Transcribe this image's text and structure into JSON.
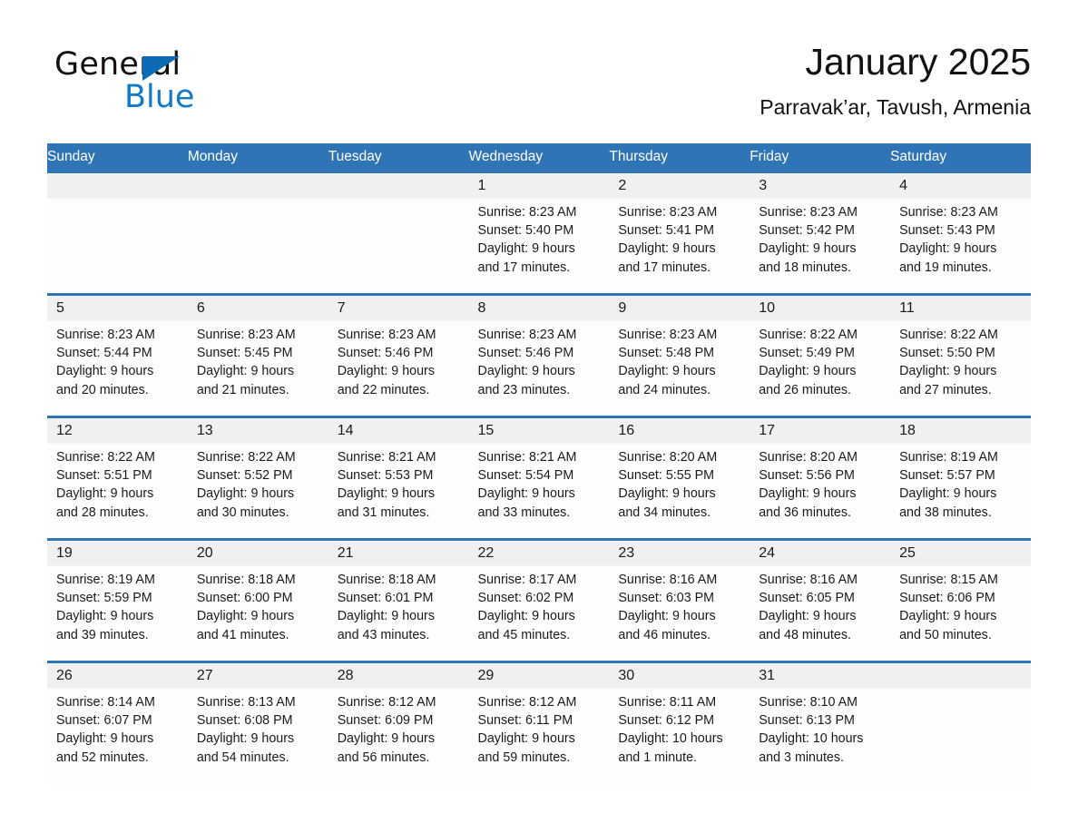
{
  "brand": {
    "name_part1": "General",
    "name_part2": "Blue",
    "triangle_color": "#0b6cb5",
    "blue_color": "#1179c6"
  },
  "header": {
    "title": "January 2025",
    "subtitle": "Parravak’ar, Tavush, Armenia"
  },
  "theme": {
    "header_blue": "#2f75b5",
    "daynum_band": "#f0f0f0",
    "cell_background": "#fdfdfd",
    "text_color": "#1a1a1a"
  },
  "calendar": {
    "weekdays": [
      "Sunday",
      "Monday",
      "Tuesday",
      "Wednesday",
      "Thursday",
      "Friday",
      "Saturday"
    ],
    "labels": {
      "sunrise": "Sunrise:",
      "sunset": "Sunset:",
      "daylight": "Daylight:"
    },
    "weeks": [
      [
        {
          "day": "",
          "l1": "",
          "l2": "",
          "l3": "",
          "l4": ""
        },
        {
          "day": "",
          "l1": "",
          "l2": "",
          "l3": "",
          "l4": ""
        },
        {
          "day": "",
          "l1": "",
          "l2": "",
          "l3": "",
          "l4": ""
        },
        {
          "day": "1",
          "l1": "Sunrise: 8:23 AM",
          "l2": "Sunset: 5:40 PM",
          "l3": "Daylight: 9 hours",
          "l4": "and 17 minutes."
        },
        {
          "day": "2",
          "l1": "Sunrise: 8:23 AM",
          "l2": "Sunset: 5:41 PM",
          "l3": "Daylight: 9 hours",
          "l4": "and 17 minutes."
        },
        {
          "day": "3",
          "l1": "Sunrise: 8:23 AM",
          "l2": "Sunset: 5:42 PM",
          "l3": "Daylight: 9 hours",
          "l4": "and 18 minutes."
        },
        {
          "day": "4",
          "l1": "Sunrise: 8:23 AM",
          "l2": "Sunset: 5:43 PM",
          "l3": "Daylight: 9 hours",
          "l4": "and 19 minutes."
        }
      ],
      [
        {
          "day": "5",
          "l1": "Sunrise: 8:23 AM",
          "l2": "Sunset: 5:44 PM",
          "l3": "Daylight: 9 hours",
          "l4": "and 20 minutes."
        },
        {
          "day": "6",
          "l1": "Sunrise: 8:23 AM",
          "l2": "Sunset: 5:45 PM",
          "l3": "Daylight: 9 hours",
          "l4": "and 21 minutes."
        },
        {
          "day": "7",
          "l1": "Sunrise: 8:23 AM",
          "l2": "Sunset: 5:46 PM",
          "l3": "Daylight: 9 hours",
          "l4": "and 22 minutes."
        },
        {
          "day": "8",
          "l1": "Sunrise: 8:23 AM",
          "l2": "Sunset: 5:46 PM",
          "l3": "Daylight: 9 hours",
          "l4": "and 23 minutes."
        },
        {
          "day": "9",
          "l1": "Sunrise: 8:23 AM",
          "l2": "Sunset: 5:48 PM",
          "l3": "Daylight: 9 hours",
          "l4": "and 24 minutes."
        },
        {
          "day": "10",
          "l1": "Sunrise: 8:22 AM",
          "l2": "Sunset: 5:49 PM",
          "l3": "Daylight: 9 hours",
          "l4": "and 26 minutes."
        },
        {
          "day": "11",
          "l1": "Sunrise: 8:22 AM",
          "l2": "Sunset: 5:50 PM",
          "l3": "Daylight: 9 hours",
          "l4": "and 27 minutes."
        }
      ],
      [
        {
          "day": "12",
          "l1": "Sunrise: 8:22 AM",
          "l2": "Sunset: 5:51 PM",
          "l3": "Daylight: 9 hours",
          "l4": "and 28 minutes."
        },
        {
          "day": "13",
          "l1": "Sunrise: 8:22 AM",
          "l2": "Sunset: 5:52 PM",
          "l3": "Daylight: 9 hours",
          "l4": "and 30 minutes."
        },
        {
          "day": "14",
          "l1": "Sunrise: 8:21 AM",
          "l2": "Sunset: 5:53 PM",
          "l3": "Daylight: 9 hours",
          "l4": "and 31 minutes."
        },
        {
          "day": "15",
          "l1": "Sunrise: 8:21 AM",
          "l2": "Sunset: 5:54 PM",
          "l3": "Daylight: 9 hours",
          "l4": "and 33 minutes."
        },
        {
          "day": "16",
          "l1": "Sunrise: 8:20 AM",
          "l2": "Sunset: 5:55 PM",
          "l3": "Daylight: 9 hours",
          "l4": "and 34 minutes."
        },
        {
          "day": "17",
          "l1": "Sunrise: 8:20 AM",
          "l2": "Sunset: 5:56 PM",
          "l3": "Daylight: 9 hours",
          "l4": "and 36 minutes."
        },
        {
          "day": "18",
          "l1": "Sunrise: 8:19 AM",
          "l2": "Sunset: 5:57 PM",
          "l3": "Daylight: 9 hours",
          "l4": "and 38 minutes."
        }
      ],
      [
        {
          "day": "19",
          "l1": "Sunrise: 8:19 AM",
          "l2": "Sunset: 5:59 PM",
          "l3": "Daylight: 9 hours",
          "l4": "and 39 minutes."
        },
        {
          "day": "20",
          "l1": "Sunrise: 8:18 AM",
          "l2": "Sunset: 6:00 PM",
          "l3": "Daylight: 9 hours",
          "l4": "and 41 minutes."
        },
        {
          "day": "21",
          "l1": "Sunrise: 8:18 AM",
          "l2": "Sunset: 6:01 PM",
          "l3": "Daylight: 9 hours",
          "l4": "and 43 minutes."
        },
        {
          "day": "22",
          "l1": "Sunrise: 8:17 AM",
          "l2": "Sunset: 6:02 PM",
          "l3": "Daylight: 9 hours",
          "l4": "and 45 minutes."
        },
        {
          "day": "23",
          "l1": "Sunrise: 8:16 AM",
          "l2": "Sunset: 6:03 PM",
          "l3": "Daylight: 9 hours",
          "l4": "and 46 minutes."
        },
        {
          "day": "24",
          "l1": "Sunrise: 8:16 AM",
          "l2": "Sunset: 6:05 PM",
          "l3": "Daylight: 9 hours",
          "l4": "and 48 minutes."
        },
        {
          "day": "25",
          "l1": "Sunrise: 8:15 AM",
          "l2": "Sunset: 6:06 PM",
          "l3": "Daylight: 9 hours",
          "l4": "and 50 minutes."
        }
      ],
      [
        {
          "day": "26",
          "l1": "Sunrise: 8:14 AM",
          "l2": "Sunset: 6:07 PM",
          "l3": "Daylight: 9 hours",
          "l4": "and 52 minutes."
        },
        {
          "day": "27",
          "l1": "Sunrise: 8:13 AM",
          "l2": "Sunset: 6:08 PM",
          "l3": "Daylight: 9 hours",
          "l4": "and 54 minutes."
        },
        {
          "day": "28",
          "l1": "Sunrise: 8:12 AM",
          "l2": "Sunset: 6:09 PM",
          "l3": "Daylight: 9 hours",
          "l4": "and 56 minutes."
        },
        {
          "day": "29",
          "l1": "Sunrise: 8:12 AM",
          "l2": "Sunset: 6:11 PM",
          "l3": "Daylight: 9 hours",
          "l4": "and 59 minutes."
        },
        {
          "day": "30",
          "l1": "Sunrise: 8:11 AM",
          "l2": "Sunset: 6:12 PM",
          "l3": "Daylight: 10 hours",
          "l4": "and 1 minute."
        },
        {
          "day": "31",
          "l1": "Sunrise: 8:10 AM",
          "l2": "Sunset: 6:13 PM",
          "l3": "Daylight: 10 hours",
          "l4": "and 3 minutes."
        },
        {
          "day": "",
          "l1": "",
          "l2": "",
          "l3": "",
          "l4": ""
        }
      ]
    ]
  }
}
